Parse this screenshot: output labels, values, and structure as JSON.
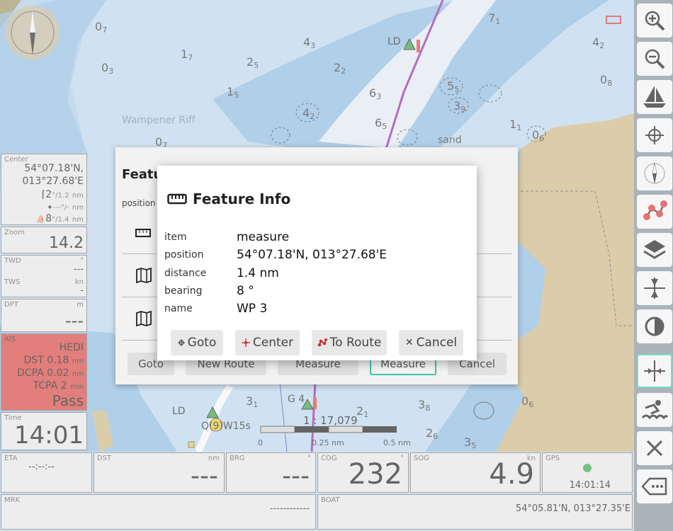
{
  "chart": {
    "place_label": "Wampener Riff",
    "sand_label": "sand",
    "beacon_ld": "LD",
    "beacon_ld2": "LD",
    "beacon_g4": "G 4",
    "light_label": "Q(9)W15s",
    "depths": [
      {
        "d": "0",
        "s": "7"
      },
      {
        "d": "1",
        "s": "7"
      },
      {
        "d": "0",
        "s": "3"
      },
      {
        "d": "2",
        "s": "5"
      },
      {
        "d": "1",
        "s": "5"
      },
      {
        "d": "4",
        "s": "3"
      },
      {
        "d": "2",
        "s": "2"
      },
      {
        "d": "6",
        "s": "3"
      },
      {
        "d": "6",
        "s": "5"
      },
      {
        "d": "4",
        "s": "2"
      },
      {
        "d": "0",
        "s": "8"
      },
      {
        "d": "7",
        "s": "1"
      },
      {
        "d": "5",
        "s": "5"
      },
      {
        "d": "1",
        "s": "1"
      },
      {
        "d": "0",
        "s": "7"
      },
      {
        "d": "3",
        "s": "1"
      },
      {
        "d": "2",
        "s": "1"
      },
      {
        "d": "3",
        "s": "8"
      },
      {
        "d": "2",
        "s": "6"
      },
      {
        "d": "0",
        "s": "6"
      },
      {
        "d": "3",
        "s": "5"
      },
      {
        "d": "0",
        "s": "6"
      },
      {
        "d": "4",
        "s": "2"
      },
      {
        "d": "3",
        "s": "9"
      }
    ],
    "scale_ratio": "1 : 17,079",
    "scale_ticks": [
      "0",
      "0.25 nm",
      "0.5 nm"
    ]
  },
  "panels": {
    "center": {
      "caption": "Center",
      "lat": "54°07.18'N,",
      "lon": "013°27.68'E",
      "row1": "2",
      "row1_units": "°/1.2",
      "row1_nm": "nm",
      "row2": "---",
      "row2_units": "°/-",
      "row2_nm": "nm",
      "row3": "8",
      "row3_units": "°/1.4",
      "row3_nm": "nm"
    },
    "zoom": {
      "caption": "Zoom",
      "value": "14.2"
    },
    "wind": {
      "twd_caption": "TWD",
      "twd_unit": "°",
      "twd_value": "---",
      "tws_caption": "TWS",
      "tws_unit": "kn",
      "tws_value": "-"
    },
    "depth": {
      "caption": "DPT",
      "unit": "m",
      "value": "---"
    },
    "ais": {
      "caption": "AIS",
      "name": "HEDI",
      "dst_label": "DST",
      "dst_value": "0.18",
      "dst_unit": "nm",
      "dcpa_label": "DCPA",
      "dcpa_value": "0.02",
      "dcpa_unit": "nm",
      "tcpa_label": "TCPA",
      "tcpa_value": "2",
      "tcpa_unit": "min",
      "status": "Pass"
    },
    "time": {
      "caption": "Time",
      "value": "14:01"
    }
  },
  "bottom": {
    "eta": {
      "caption": "ETA",
      "value": "--:--:--"
    },
    "dst": {
      "caption": "DST",
      "unit": "nm",
      "value": "---"
    },
    "brg": {
      "caption": "BRG",
      "unit": "°",
      "value": "---"
    },
    "cog": {
      "caption": "COG",
      "unit": "°",
      "value": "232"
    },
    "sog": {
      "caption": "SOG",
      "unit": "kn",
      "value": "4.9"
    },
    "gps": {
      "caption": "GPS",
      "time": "14:01:14"
    },
    "mrk": {
      "caption": "MRK",
      "value": "------------"
    },
    "boat": {
      "caption": "BOAT",
      "value": "54°05.81'N, 013°27.35'E"
    }
  },
  "underlay": {
    "title": "Featu",
    "position_label": "position",
    "buttons": [
      "Goto",
      "New Route",
      "Measure",
      "Measure",
      "Cancel"
    ]
  },
  "dialog": {
    "title": "Feature Info",
    "rows": [
      {
        "label": "item",
        "value": "measure"
      },
      {
        "label": "position",
        "value": "54°07.18'N, 013°27.68'E"
      },
      {
        "label": "distance",
        "value": "1.4 nm"
      },
      {
        "label": "bearing",
        "value": "8 °"
      },
      {
        "label": "name",
        "value": "WP 3"
      }
    ],
    "buttons": {
      "goto": "Goto",
      "center": "Center",
      "to_route": "To Route",
      "cancel": "Cancel"
    }
  },
  "colors": {
    "ais_bg": "#d33a35",
    "active_border": "#39c6a8",
    "land": "#c8b27c",
    "shallow": "#86b6de",
    "deep": "#b7d3ea",
    "route": "#8a1fa8"
  }
}
